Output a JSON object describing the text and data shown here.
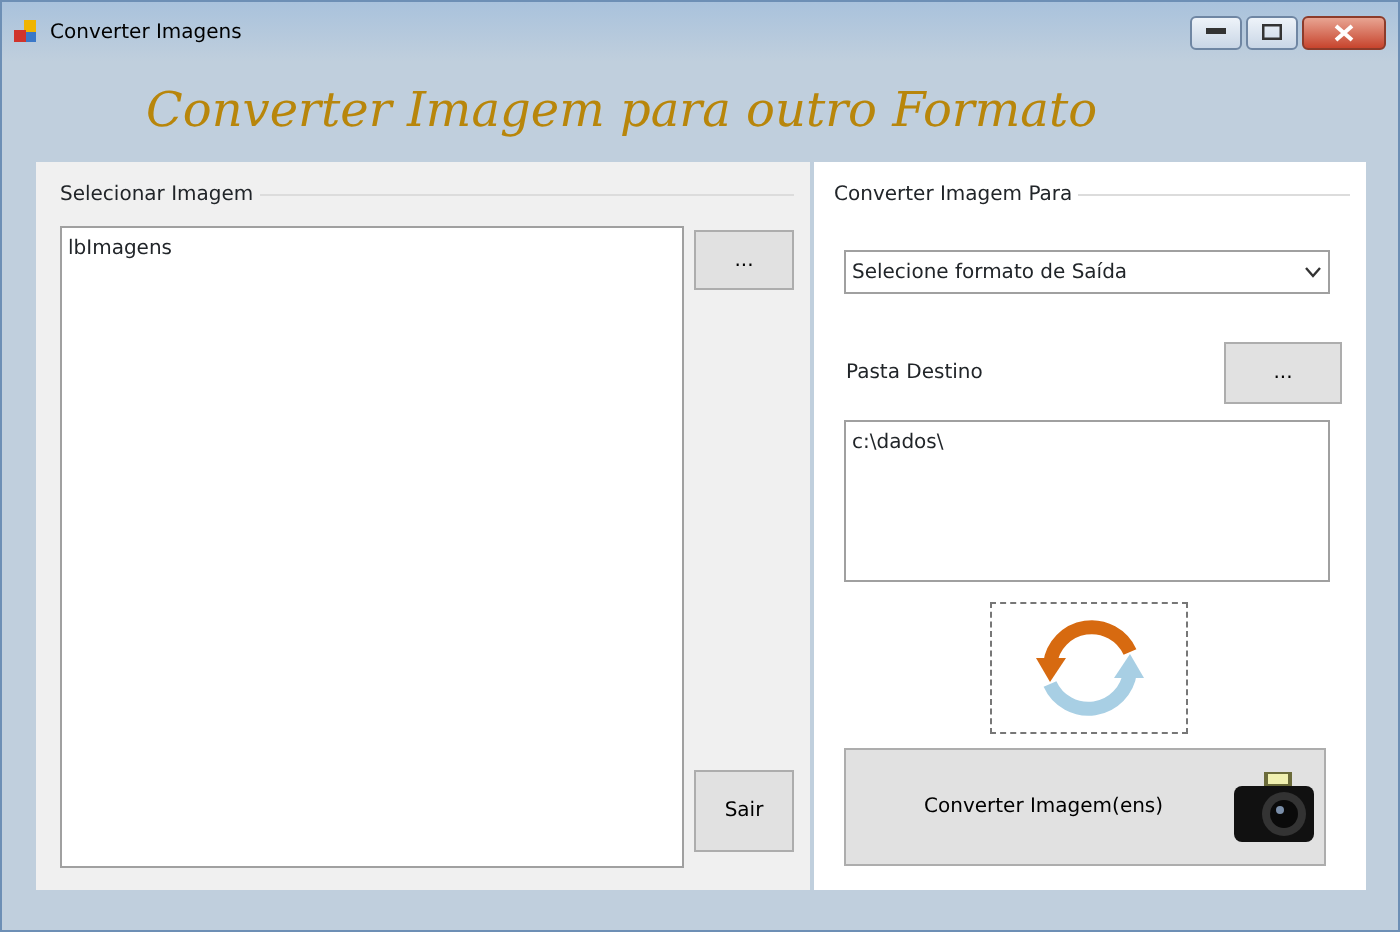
{
  "window": {
    "title": "Converter Imagens"
  },
  "heading": "Converter Imagem para outro Formato",
  "select_group": {
    "legend": "Selecionar Imagem",
    "list_text": "lbImagens",
    "browse_button": "...",
    "exit_button": "Sair"
  },
  "convert_group": {
    "legend": "Converter Imagem Para",
    "format_dropdown": "Selecione formato de Saída",
    "folder_label": "Pasta Destino",
    "folder_button": "...",
    "folder_value": "c:\\dados\\",
    "convert_button": "Converter Imagem(ens)"
  }
}
